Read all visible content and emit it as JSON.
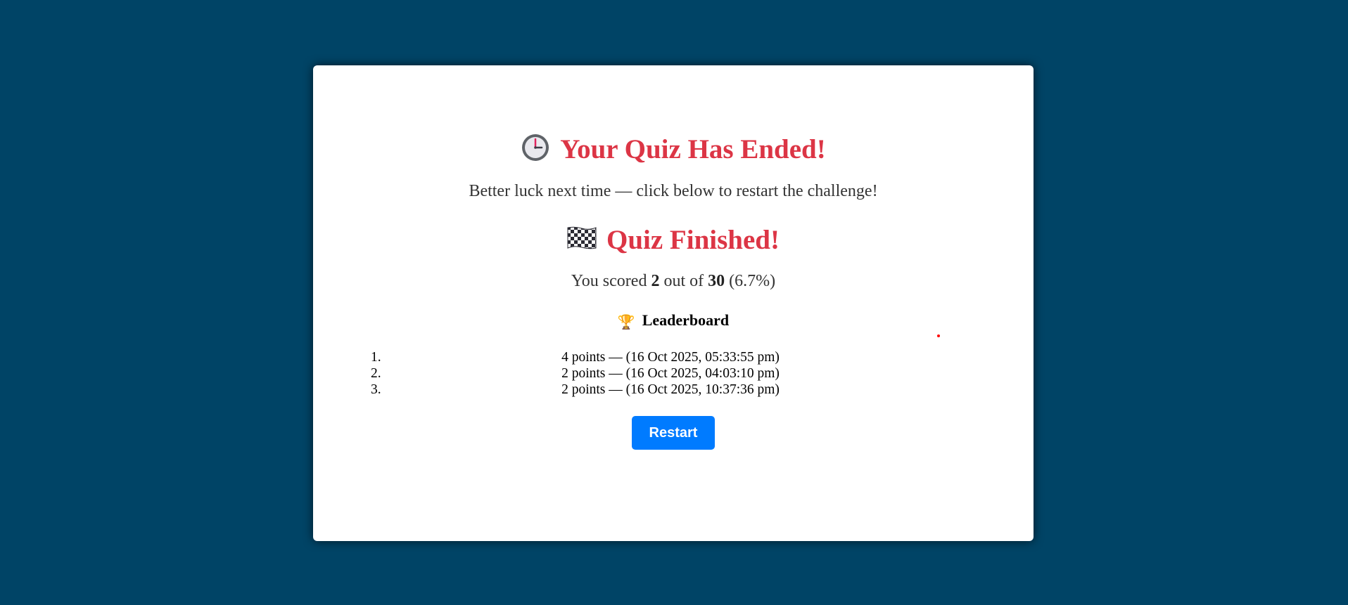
{
  "quiz_end": {
    "icon": "clock-icon",
    "title": "Your Quiz Has Ended!",
    "subtitle": "Better luck next time — click below to restart the challenge!"
  },
  "result": {
    "icon": "checkered-flag-icon",
    "title": "Quiz Finished!",
    "score_prefix": "You scored ",
    "score": "2",
    "score_middle": " out of ",
    "total": "30",
    "percent_text": " (6.7%)"
  },
  "leaderboard": {
    "icon": "trophy-icon",
    "title": "Leaderboard",
    "entries": [
      {
        "rank": "1.",
        "text": "4 points — (16 Oct 2025, 05:33:55 pm)"
      },
      {
        "rank": "2.",
        "text": "2 points — (16 Oct 2025, 04:03:10 pm)"
      },
      {
        "rank": "3.",
        "text": "2 points — (16 Oct 2025, 10:37:36 pm)"
      }
    ]
  },
  "actions": {
    "restart_label": "Restart"
  },
  "colors": {
    "background": "#004466",
    "card": "#ffffff",
    "heading_red": "#dc3545",
    "button_blue": "#007bff"
  }
}
